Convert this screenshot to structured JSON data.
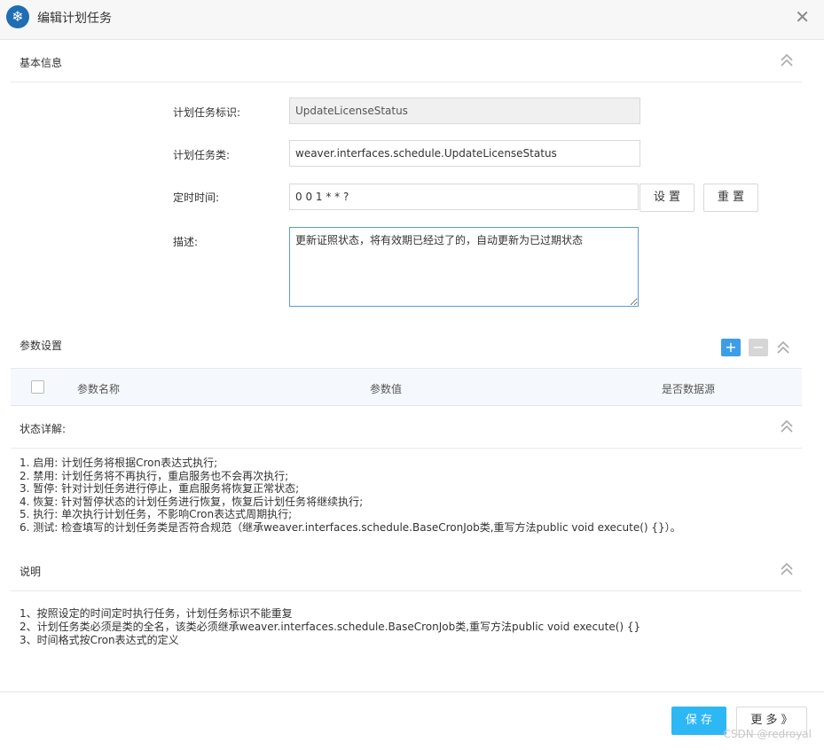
{
  "window": {
    "title": "编辑计划任务"
  },
  "sections": {
    "basic": "基本信息",
    "params": "参数设置",
    "status": "状态详解:",
    "notes": "说明"
  },
  "form": {
    "task_id_label": "计划任务标识:",
    "task_id_value": "UpdateLicenseStatus",
    "task_class_label": "计划任务类:",
    "task_class_value": "weaver.interfaces.schedule.UpdateLicenseStatus",
    "cron_label": "定时时间:",
    "cron_value": "0 0 1 * * ?",
    "set_button": "设 置",
    "reset_button": "重 置",
    "desc_label": "描述:",
    "desc_value": "更新证照状态，将有效期已经过了的，自动更新为已过期状态"
  },
  "param_table": {
    "columns": [
      "参数名称",
      "参数值",
      "是否数据源"
    ],
    "add_icon": "plus-icon",
    "remove_icon": "minus-icon"
  },
  "status_lines": [
    "1. 启用: 计划任务将根据Cron表达式执行;",
    "2. 禁用: 计划任务将不再执行，重启服务也不会再次执行;",
    "3. 暂停: 针对计划任务进行停止，重启服务将恢复正常状态;",
    "4. 恢复: 针对暂停状态的计划任务进行恢复，恢复后计划任务将继续执行;",
    "5. 执行: 单次执行计划任务，不影响Cron表达式周期执行;",
    "6. 测试: 检查填写的计划任务类是否符合规范（继承weaver.interfaces.schedule.BaseCronJob类,重写方法public void execute() {}）。"
  ],
  "note_lines": [
    "1、按照设定的时间定时执行任务，计划任务标识不能重复",
    "2、计划任务类必须是类的全名，该类必须继承weaver.interfaces.schedule.BaseCronJob类,重写方法public void execute() {}",
    "3、时间格式按Cron表达式的定义"
  ],
  "footer": {
    "save_button": "保 存",
    "more_button": "更 多 》",
    "watermark": "CSDN @redroyal"
  },
  "colors": {
    "primary": "#2db7f5",
    "logo": "#1f6db3",
    "add_button": "#3d9ee8",
    "remove_button": "#d6d6d6"
  }
}
